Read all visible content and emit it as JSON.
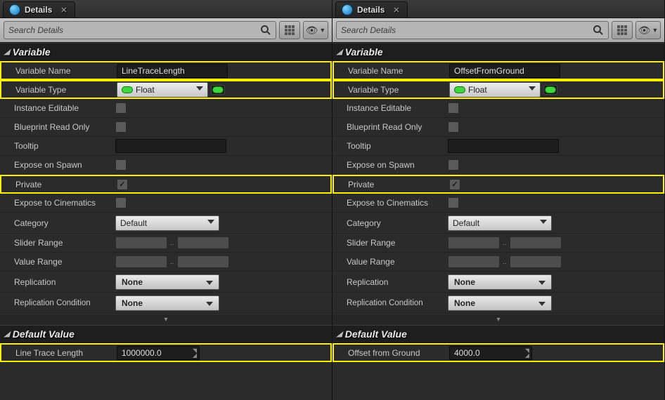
{
  "panels": [
    {
      "tab_title": "Details",
      "search_placeholder": "Search Details",
      "variable_section": "Variable",
      "default_section": "Default Value",
      "labels": {
        "variable_name": "Variable Name",
        "variable_type": "Variable Type",
        "instance_editable": "Instance Editable",
        "blueprint_read_only": "Blueprint Read Only",
        "tooltip": "Tooltip",
        "expose_on_spawn": "Expose on Spawn",
        "private": "Private",
        "expose_cinematics": "Expose to Cinematics",
        "category": "Category",
        "slider_range": "Slider Range",
        "value_range": "Value Range",
        "replication": "Replication",
        "replication_condition": "Replication Condition"
      },
      "values": {
        "variable_name": "LineTraceLength",
        "variable_type": "Float",
        "instance_editable": false,
        "blueprint_read_only": false,
        "tooltip": "",
        "expose_on_spawn": false,
        "private": true,
        "expose_cinematics": false,
        "category": "Default",
        "replication": "None",
        "replication_condition": "None"
      },
      "default_value": {
        "label": "Line Trace Length",
        "value": "1000000.0"
      }
    },
    {
      "tab_title": "Details",
      "search_placeholder": "Search Details",
      "variable_section": "Variable",
      "default_section": "Default Value",
      "labels": {
        "variable_name": "Variable Name",
        "variable_type": "Variable Type",
        "instance_editable": "Instance Editable",
        "blueprint_read_only": "Blueprint Read Only",
        "tooltip": "Tooltip",
        "expose_on_spawn": "Expose on Spawn",
        "private": "Private",
        "expose_cinematics": "Expose to Cinematics",
        "category": "Category",
        "slider_range": "Slider Range",
        "value_range": "Value Range",
        "replication": "Replication",
        "replication_condition": "Replication Condition"
      },
      "values": {
        "variable_name": "OffsetFromGround",
        "variable_type": "Float",
        "instance_editable": false,
        "blueprint_read_only": false,
        "tooltip": "",
        "expose_on_spawn": false,
        "private": true,
        "expose_cinematics": false,
        "category": "Default",
        "replication": "None",
        "replication_condition": "None"
      },
      "default_value": {
        "label": "Offset from Ground",
        "value": "4000.0"
      }
    }
  ]
}
